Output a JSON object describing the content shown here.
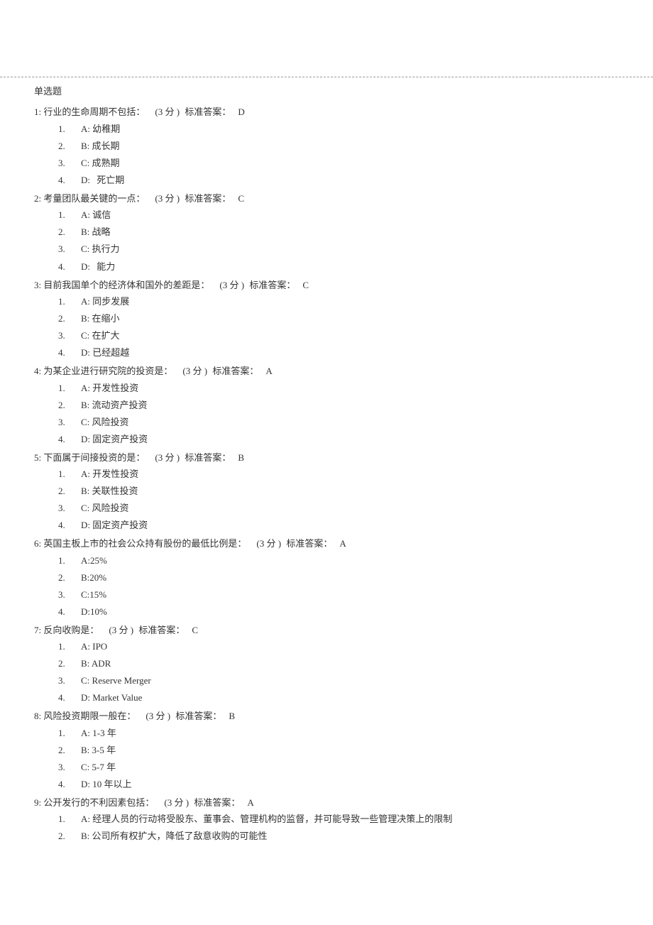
{
  "section_title": "单选题",
  "score_open": "(",
  "score_close": ")",
  "score_unit": "分",
  "answer_label": "标准答案：",
  "questions": [
    {
      "num": "1:",
      "text": "行业的生命周期不包括：",
      "score": "3",
      "answer": "D",
      "options": [
        {
          "n": "1.",
          "letter": "A:",
          "text": "幼稚期",
          "spaced": false
        },
        {
          "n": "2.",
          "letter": "B:",
          "text": "成长期",
          "spaced": false
        },
        {
          "n": "3.",
          "letter": "C:",
          "text": "成熟期",
          "spaced": false
        },
        {
          "n": "4.",
          "letter": "D:",
          "text": "死亡期",
          "spaced": true
        }
      ]
    },
    {
      "num": "2:",
      "text": "考量团队最关键的一点：",
      "score": "3",
      "answer": "C",
      "options": [
        {
          "n": "1.",
          "letter": "A:",
          "text": "诚信",
          "spaced": false
        },
        {
          "n": "2.",
          "letter": "B:",
          "text": "战略",
          "spaced": false
        },
        {
          "n": "3.",
          "letter": "C:",
          "text": "执行力",
          "spaced": false
        },
        {
          "n": "4.",
          "letter": "D:",
          "text": "能力",
          "spaced": true
        }
      ]
    },
    {
      "num": "3:",
      "text": "目前我国单个的经济体和国外的差距是：",
      "score": "3",
      "answer": "C",
      "options": [
        {
          "n": "1.",
          "letter": "A:",
          "text": "同步发展",
          "spaced": false
        },
        {
          "n": "2.",
          "letter": "B:",
          "text": "在缩小",
          "spaced": false
        },
        {
          "n": "3.",
          "letter": "C:",
          "text": "在扩大",
          "spaced": false
        },
        {
          "n": "4.",
          "letter": "D:",
          "text": "已经超越",
          "spaced": false
        }
      ]
    },
    {
      "num": "4:",
      "text": "为某企业进行研究院的投资是：",
      "score": "3",
      "answer": "A",
      "options": [
        {
          "n": "1.",
          "letter": "A:",
          "text": "开发性投资",
          "spaced": false
        },
        {
          "n": "2.",
          "letter": "B:",
          "text": "流动资产投资",
          "spaced": false
        },
        {
          "n": "3.",
          "letter": "C:",
          "text": "风险投资",
          "spaced": false
        },
        {
          "n": "4.",
          "letter": "D:",
          "text": "固定资产投资",
          "spaced": false
        }
      ]
    },
    {
      "num": "5:",
      "text": "下面属于间接投资的是：",
      "score": "3",
      "answer": "B",
      "options": [
        {
          "n": "1.",
          "letter": "A:",
          "text": "开发性投资",
          "spaced": false
        },
        {
          "n": "2.",
          "letter": "B:",
          "text": "关联性投资",
          "spaced": false
        },
        {
          "n": "3.",
          "letter": "C:",
          "text": "风险投资",
          "spaced": false
        },
        {
          "n": "4.",
          "letter": "D:",
          "text": "固定资产投资",
          "spaced": false
        }
      ]
    },
    {
      "num": "6:",
      "text": "英国主板上市的社会公众持有股份的最低比例是：",
      "score": "3",
      "answer": "A",
      "options": [
        {
          "n": "1.",
          "letter": "A:",
          "text": "25%",
          "spaced": false,
          "tight": true
        },
        {
          "n": "2.",
          "letter": "B:",
          "text": "20%",
          "spaced": false,
          "tight": true
        },
        {
          "n": "3.",
          "letter": "C:",
          "text": "15%",
          "spaced": false,
          "tight": true
        },
        {
          "n": "4.",
          "letter": "D:",
          "text": "10%",
          "spaced": false,
          "tight": true
        }
      ]
    },
    {
      "num": "7:",
      "text": "反向收购是：",
      "score": "3",
      "answer": "C",
      "options": [
        {
          "n": "1.",
          "letter": "A:",
          "text": "IPO",
          "spaced": false
        },
        {
          "n": "2.",
          "letter": "B:",
          "text": "ADR",
          "spaced": false
        },
        {
          "n": "3.",
          "letter": "C:",
          "text": "Reserve Merger",
          "spaced": false
        },
        {
          "n": "4.",
          "letter": "D:",
          "text": "Market Value",
          "spaced": false
        }
      ]
    },
    {
      "num": "8:",
      "text": "风险投资期限一般在：",
      "score": "3",
      "answer": "B",
      "options": [
        {
          "n": "1.",
          "letter": "A:",
          "text": "1-3    年",
          "spaced": false
        },
        {
          "n": "2.",
          "letter": "B:",
          "text": "3-5    年",
          "spaced": false
        },
        {
          "n": "3.",
          "letter": "C:",
          "text": "5-7    年",
          "spaced": false
        },
        {
          "n": "4.",
          "letter": "D:",
          "text": "10   年以上",
          "spaced": false
        }
      ]
    },
    {
      "num": "9:",
      "text": "公开发行的不利因素包括：",
      "score": "3",
      "answer": "A",
      "options": [
        {
          "n": "1.",
          "letter": "A:",
          "text": "经理人员的行动将受股东、董事会、管理机构的监督，并可能导致一些管理决策上的限制",
          "spaced": false
        },
        {
          "n": "2.",
          "letter": "B:",
          "text": "公司所有权扩大，降低了敌意收购的可能性",
          "spaced": false
        }
      ]
    }
  ]
}
